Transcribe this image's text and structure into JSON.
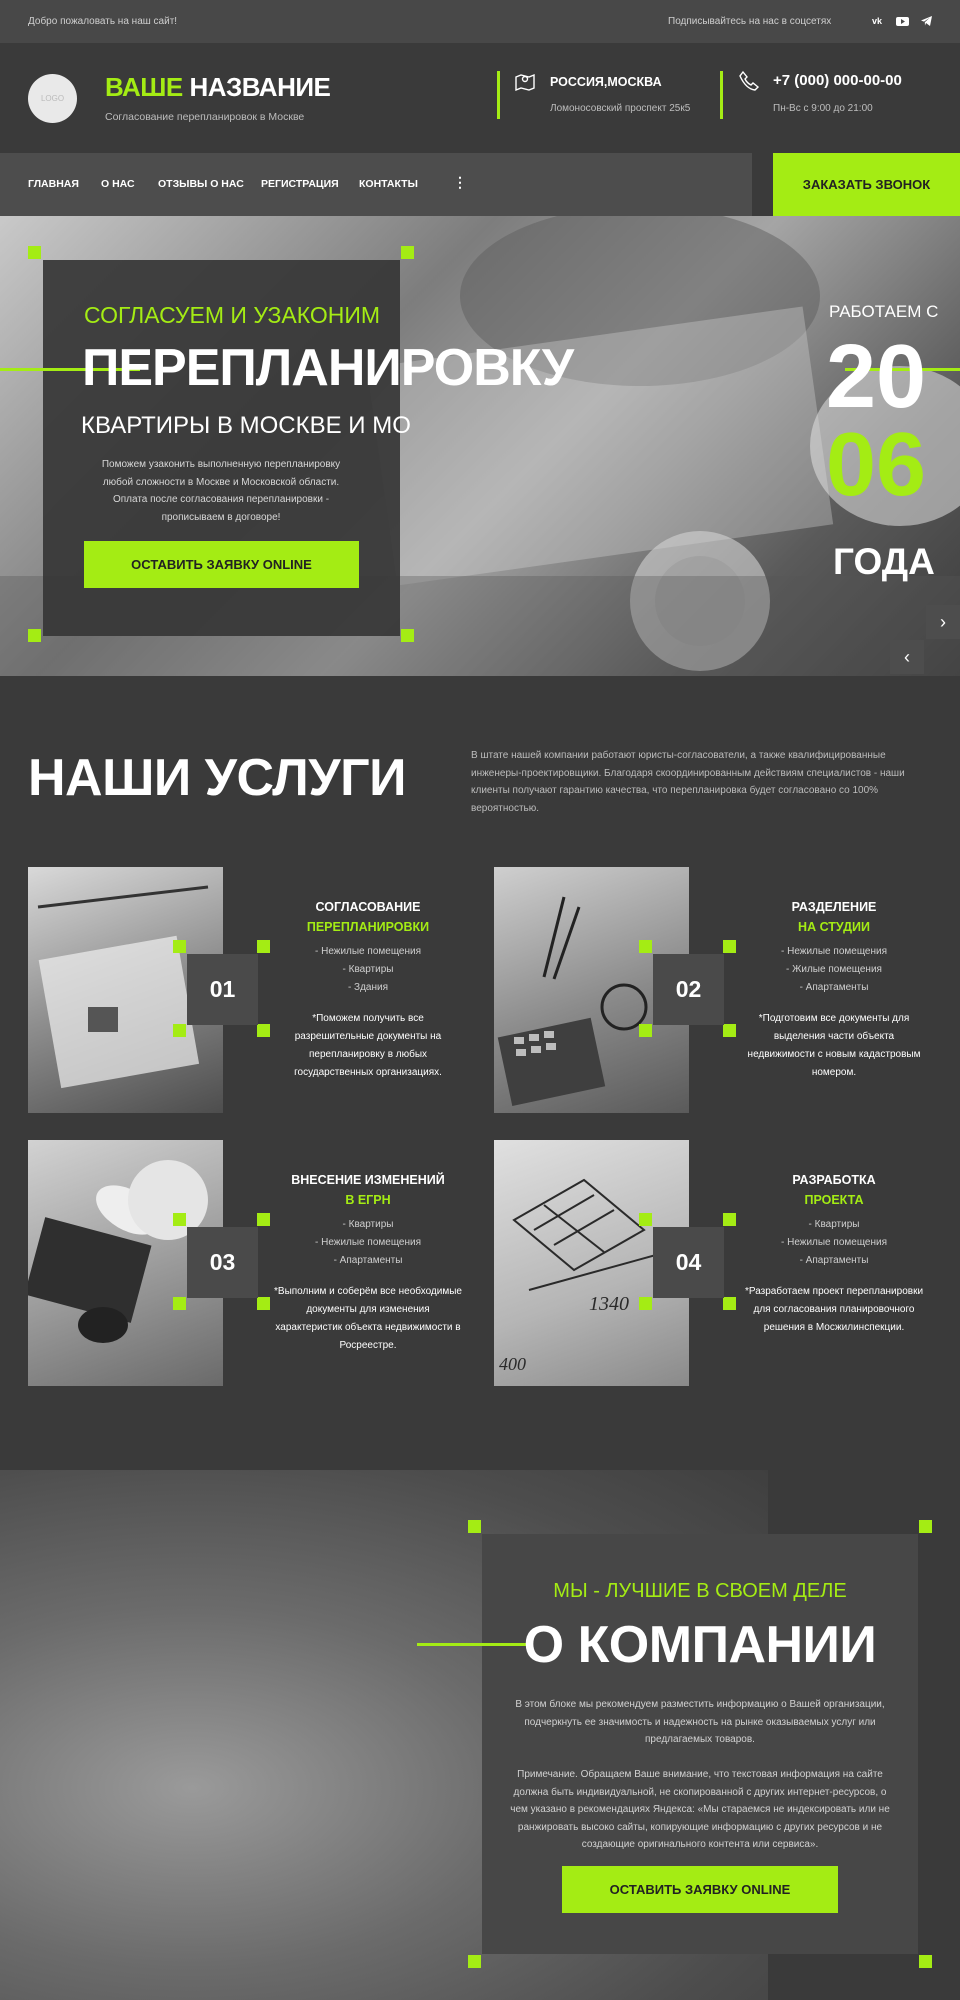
{
  "topbar": {
    "welcome": "Добро пожаловать на наш сайт!",
    "subscribe": "Подписывайтесь на нас в соцсетях",
    "socials": [
      {
        "icon": "vk-icon",
        "glyph": "vk"
      },
      {
        "icon": "youtube-icon",
        "glyph": "▶"
      },
      {
        "icon": "telegram-icon",
        "glyph": "➤"
      }
    ]
  },
  "header": {
    "logo": "LOGO",
    "brand_accent": "ВАШЕ",
    "brand_rest": "НАЗВАНИЕ",
    "tagline": "Согласование перепланировок в Москве",
    "location": {
      "title": "РОССИЯ,МОСКВА",
      "sub": "Ломоносовский проспект 25к5"
    },
    "phone": {
      "title": "+7 (000) 000-00-00",
      "sub": "Пн-Вс с 9:00 до 21:00"
    }
  },
  "nav": {
    "items": [
      "ГЛАВНАЯ",
      "О НАС",
      "ОТЗЫВЫ О НАС",
      "РЕГИСТРАЦИЯ",
      "КОНТАКТЫ"
    ],
    "more": "⋮",
    "cta": "ЗАКАЗАТЬ ЗВОНОК"
  },
  "hero": {
    "kicker": "СОГЛАСУЕМ И УЗАКОНИМ",
    "title": "ПЕРЕПЛАНИРОВКУ",
    "subtitle": "КВАРТИРЫ В МОСКВЕ И МО",
    "text": "Поможем узаконить выполненную перепланировку любой сложности в Москве и Московской области. Оплата после согласования перепланировки - прописываем в договоре!",
    "button": "ОСТАВИТЬ ЗАЯВКУ ONLINE",
    "since_label": "РАБОТАЕМ С",
    "year_top": "20",
    "year_bottom": "06",
    "years_label": "ГОДА",
    "next": "›",
    "prev": "‹"
  },
  "services": {
    "title": "НАШИ УСЛУГИ",
    "intro": "В штате нашей компании работают юристы-согласователи, а также квалифицированные инженеры-проектировщики. Благодаря скоординированным действиям специалистов - наши клиенты получают гарантию качества, что перепланировка будет согласовано со 100% вероятностью.",
    "cards": [
      {
        "num": "01",
        "title": "СОГЛАСОВАНИЕ",
        "title_accent": "ПЕРЕПЛАНИРОВКИ",
        "list": [
          "- Нежилые помещения",
          "- Квартиры",
          "- Здания"
        ],
        "desc": "*Поможем получить все разрешительные документы на перепланировку в любых государственных организациях."
      },
      {
        "num": "02",
        "title": "РАЗДЕЛЕНИЕ",
        "title_accent": "НА СТУДИИ",
        "list": [
          "- Нежилые помещения",
          "- Жилые помещения",
          "- Апартаменты"
        ],
        "desc": "*Подготовим все документы для выделения части объекта недвижимости с новым кадастровым номером."
      },
      {
        "num": "03",
        "title": "ВНЕСЕНИЕ ИЗМЕНЕНИЙ",
        "title_accent": "В ЕГРН",
        "list": [
          "- Квартиры",
          "- Нежилые помещения",
          "- Апартаменты"
        ],
        "desc": "*Выполним и соберём все необходимые документы для изменения характеристик объекта недвижимости в Росреестре."
      },
      {
        "num": "04",
        "title": "РАЗРАБОТКА",
        "title_accent": "ПРОЕКТА",
        "list": [
          "- Квартиры",
          "- Нежилые помещения",
          "- Апартаменты"
        ],
        "desc": "*Разработаем проект перепланировки для согласования планировочного решения в Мосжилинспекции."
      }
    ]
  },
  "about": {
    "kicker": "МЫ - ЛУЧШИЕ В СВОЕМ ДЕЛЕ",
    "title": "О КОМПАНИИ",
    "p1": "В этом блоке мы рекомендуем разместить информацию о Вашей организации, подчеркнуть ее значимость и надежность на рынке оказываемых услуг или предлагаемых товаров.",
    "p2": "Примечание. Обращаем Ваше внимание, что текстовая информация на сайте должна быть индивидуальной, не скопированной с других интернет-ресурсов, о чем указано в рекомендациях Яндекса: «Мы стараемся не индексировать или не ранжировать высоко сайты, копирующие информацию с других ресурсов и не создающие оригинального контента или сервиса».",
    "button": "ОСТАВИТЬ ЗАЯВКУ ONLINE"
  },
  "colors": {
    "accent": "#a4ec14",
    "bg": "#3a3a3a"
  }
}
